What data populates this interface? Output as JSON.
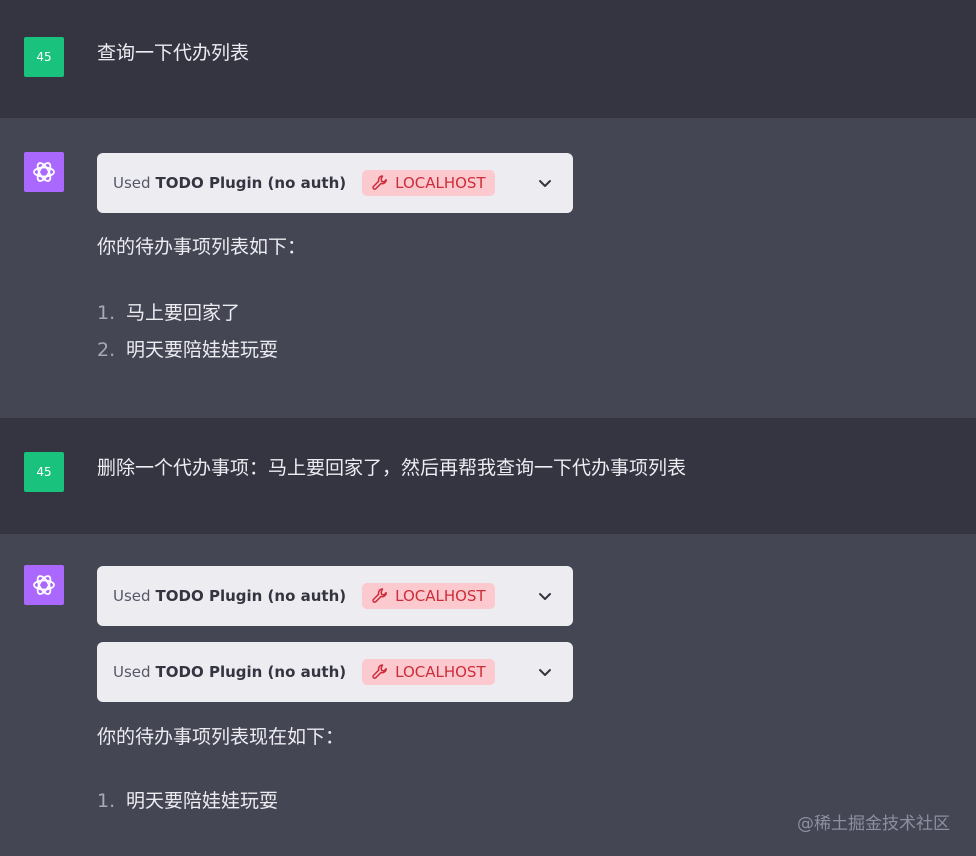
{
  "user_avatar_text": "45",
  "turns": [
    {
      "user": "查询一下代办列表",
      "plugins": [
        {
          "used": "Used",
          "name": "TODO Plugin (no auth)",
          "badge": "LOCALHOST"
        }
      ],
      "reply": "你的待办事项列表如下：",
      "items": [
        {
          "num": "1.",
          "text": "马上要回家了"
        },
        {
          "num": "2.",
          "text": "明天要陪娃娃玩耍"
        }
      ]
    },
    {
      "user": "删除一个代办事项：马上要回家了，然后再帮我查询一下代办事项列表",
      "plugins": [
        {
          "used": "Used",
          "name": "TODO Plugin (no auth)",
          "badge": "LOCALHOST"
        },
        {
          "used": "Used",
          "name": "TODO Plugin (no auth)",
          "badge": "LOCALHOST"
        }
      ],
      "reply": "你的待办事项列表现在如下：",
      "items": [
        {
          "num": "1.",
          "text": "明天要陪娃娃玩耍"
        }
      ]
    }
  ],
  "watermark": "@稀土掘金技术社区",
  "icons": {
    "user_avatar": "user-avatar-icon",
    "assistant_avatar": "openai-logo-icon",
    "plugin_badge": "wrench-icon",
    "expand": "chevron-down-icon"
  },
  "colors": {
    "user_bg": "#343541",
    "assistant_bg": "#444654",
    "user_avatar": "#19c37d",
    "assistant_avatar": "#ab68ff",
    "badge_bg": "#fcc9cf",
    "badge_text": "#cc2d3a"
  }
}
